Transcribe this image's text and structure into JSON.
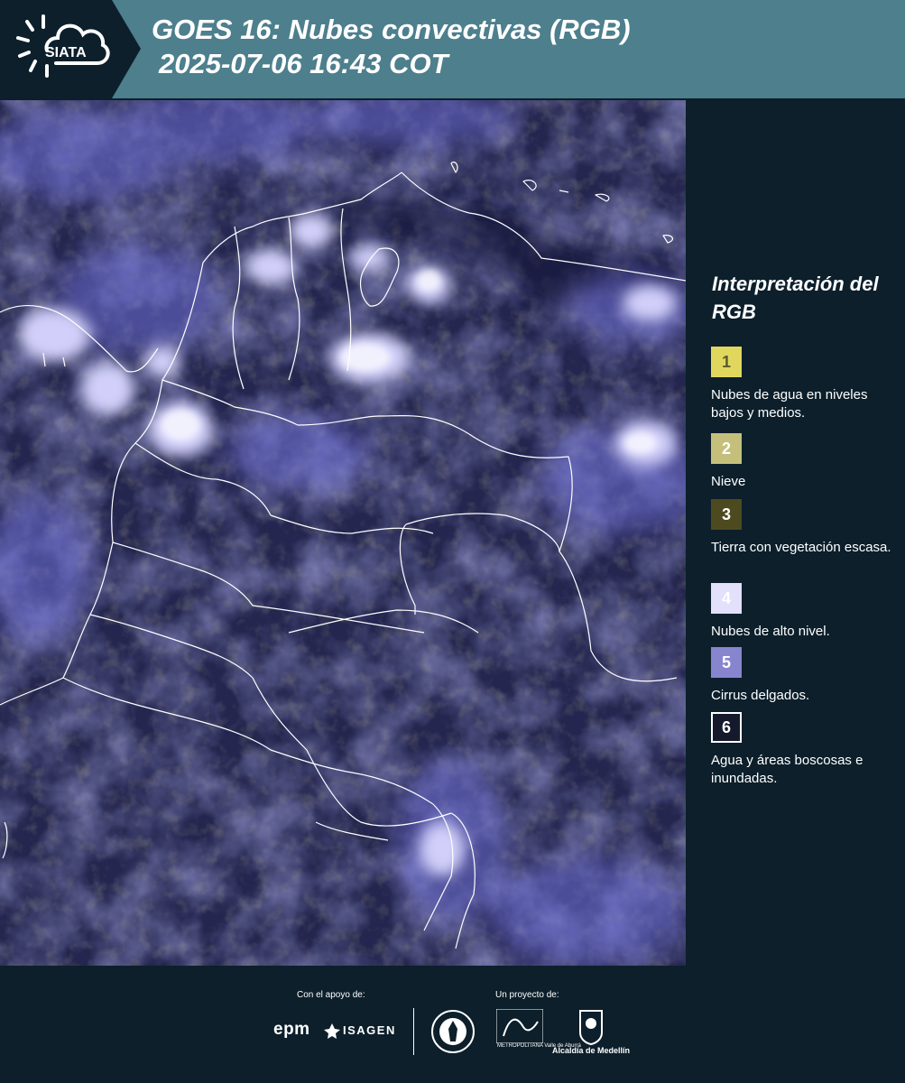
{
  "header": {
    "logo_text": "SIATA",
    "title_line1": "GOES 16: Nubes convectivas (RGB)",
    "title_line2": "2025-07-06 16:43 COT",
    "background_color": "#4d7f8d"
  },
  "legend": {
    "title": "Interpretación del RGB",
    "items": [
      {
        "number": "1",
        "label": "Nubes de agua en niveles bajos y medios.",
        "color": "#e0d85e",
        "text_color": "#5a5a2a"
      },
      {
        "number": "2",
        "label": "Nieve",
        "color": "#c4c07c",
        "text_color": "#ffffff"
      },
      {
        "number": "3",
        "label": "Tierra con vegetación escasa.",
        "color": "#4e4a20",
        "text_color": "#ffffff"
      },
      {
        "number": "4",
        "label": "Nubes de alto nivel.",
        "color": "#e2e0fb",
        "text_color": "#ffffff"
      },
      {
        "number": "5",
        "label": "Cirrus delgados.",
        "color": "#8885cf",
        "text_color": "#ffffff"
      },
      {
        "number": "6",
        "label": "Agua y áreas boscosas e inundadas.",
        "color": "#141a2c",
        "text_color": "#ffffff"
      }
    ]
  },
  "footer": {
    "support_label": "Con el apoyo de:",
    "project_label": "Un proyecto de:",
    "sponsors": [
      "epm",
      "ISAGEN"
    ],
    "partners": [
      "METROPOLITANA Valle de Aburrá",
      "Alcaldía de Medellín"
    ]
  }
}
